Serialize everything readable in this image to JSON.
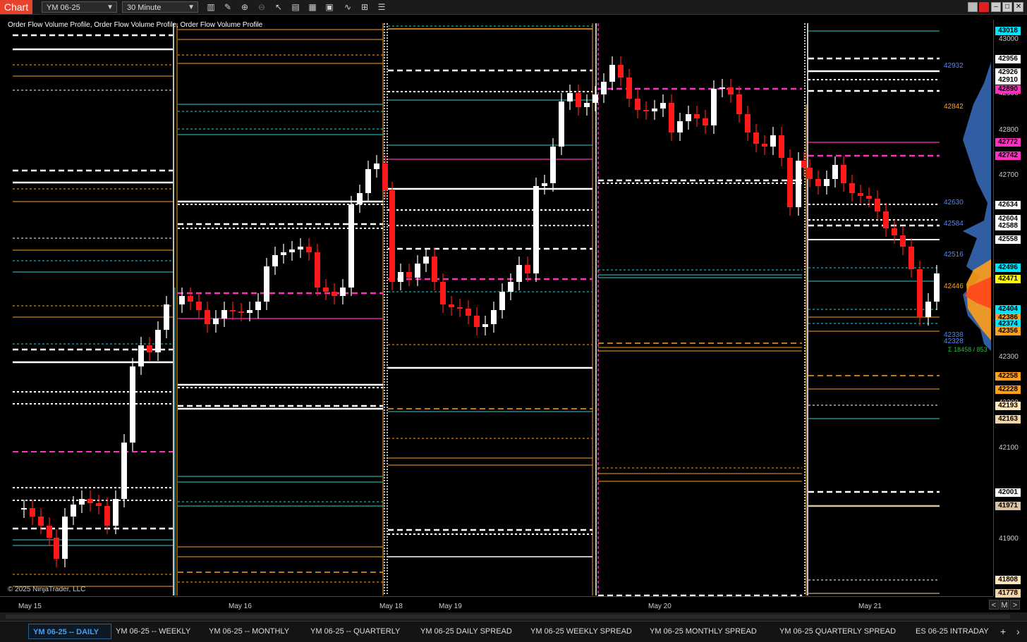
{
  "toolbar": {
    "app_label": "Chart",
    "instrument": "YM 06-25",
    "interval": "30 Minute"
  },
  "chart": {
    "indicator_label": "Order Flow Volume Profile, Order Flow Volume Profile, Order Flow Volume Profile",
    "copyright": "© 2025 NinjaTrader, LLC",
    "price_ticks": [
      "43000",
      "42900",
      "42800",
      "42700",
      "42300",
      "42200",
      "42100",
      "41900"
    ],
    "price_labels": [
      {
        "text": "43018",
        "color": "#00e5ff"
      },
      {
        "text": "42956",
        "color": "#ffffff"
      },
      {
        "text": "42926",
        "color": "#ffffff"
      },
      {
        "text": "42910",
        "color": "#ffffff"
      },
      {
        "text": "42890",
        "color": "#ff2fc0"
      },
      {
        "text": "42772",
        "color": "#ff2fc0"
      },
      {
        "text": "42742",
        "color": "#ff2fc0"
      },
      {
        "text": "42634",
        "color": "#ffffff"
      },
      {
        "text": "42604",
        "color": "#ffffff"
      },
      {
        "text": "42588",
        "color": "#ffffff"
      },
      {
        "text": "42558",
        "color": "#ffffff"
      },
      {
        "text": "42496",
        "color": "#00e5ff"
      },
      {
        "text": "42471",
        "color": "#ffff00"
      },
      {
        "text": "42404",
        "color": "#00e5ff"
      },
      {
        "text": "42386",
        "color": "#ff9f1a"
      },
      {
        "text": "42374",
        "color": "#00e5ff"
      },
      {
        "text": "42356",
        "color": "#ff9f1a"
      },
      {
        "text": "42258",
        "color": "#ff9f1a"
      },
      {
        "text": "42228",
        "color": "#ff9f1a"
      },
      {
        "text": "42193",
        "color": "#ffe6b8"
      },
      {
        "text": "42163",
        "color": "#f3d3a8"
      },
      {
        "text": "42001",
        "color": "#ffffff"
      },
      {
        "text": "41971",
        "color": "#d9c3a3"
      },
      {
        "text": "41808",
        "color": "#ffe6b8"
      },
      {
        "text": "41778",
        "color": "#f3d3a8"
      }
    ],
    "profile_tags": [
      {
        "text": "42932",
        "color": "#4f86ff"
      },
      {
        "text": "42842",
        "color": "#ff9f1a"
      },
      {
        "text": "42630",
        "color": "#4f86ff"
      },
      {
        "text": "42584",
        "color": "#4f86ff"
      },
      {
        "text": "42516",
        "color": "#4f86ff"
      },
      {
        "text": "42446",
        "color": "#ff9f1a"
      },
      {
        "text": "42338",
        "color": "#4f86ff"
      },
      {
        "text": "42328",
        "color": "#4f86ff"
      }
    ],
    "volume_summary": "Σ 18458 / 853",
    "time_labels": [
      "May 15",
      "May 16",
      "May 18",
      "May 19",
      "May 20",
      "May 21"
    ]
  },
  "tabs": [
    {
      "label": "YM 06-25 -- DAILY",
      "active": true
    },
    {
      "label": "YM 06-25 -- WEEKLY"
    },
    {
      "label": "YM 06-25 -- MONTHLY"
    },
    {
      "label": "YM 06-25 -- QUARTERLY"
    },
    {
      "label": "YM 06-25 DAILY SPREAD"
    },
    {
      "label": "YM 06-25 WEEKLY SPREAD"
    },
    {
      "label": "YM 06-25 MONTHLY SPREAD"
    },
    {
      "label": "YM 06-25 QUARTERLY SPREAD"
    },
    {
      "label": "ES 06-25 INTRADAY"
    }
  ],
  "tab_controls": {
    "add": "+",
    "next": "›",
    "scroll_left": "<",
    "scroll_mode": "M",
    "scroll_right": ">"
  },
  "icons": [
    "bar-chart-icon",
    "pencil-icon",
    "zoom-in-icon",
    "zoom-out-icon",
    "pointer-icon",
    "properties-icon",
    "templates-icon",
    "data-box-icon",
    "indicators-icon",
    "strategies-icon",
    "menu-icon"
  ],
  "colors": {
    "up": "#ffffff",
    "down": "#ff1a1a",
    "poc": "#ff2fc0",
    "value_area_cyan": "#2fd0d0",
    "value_area_orange": "#ff9f1a",
    "accent": "#e8412c"
  }
}
